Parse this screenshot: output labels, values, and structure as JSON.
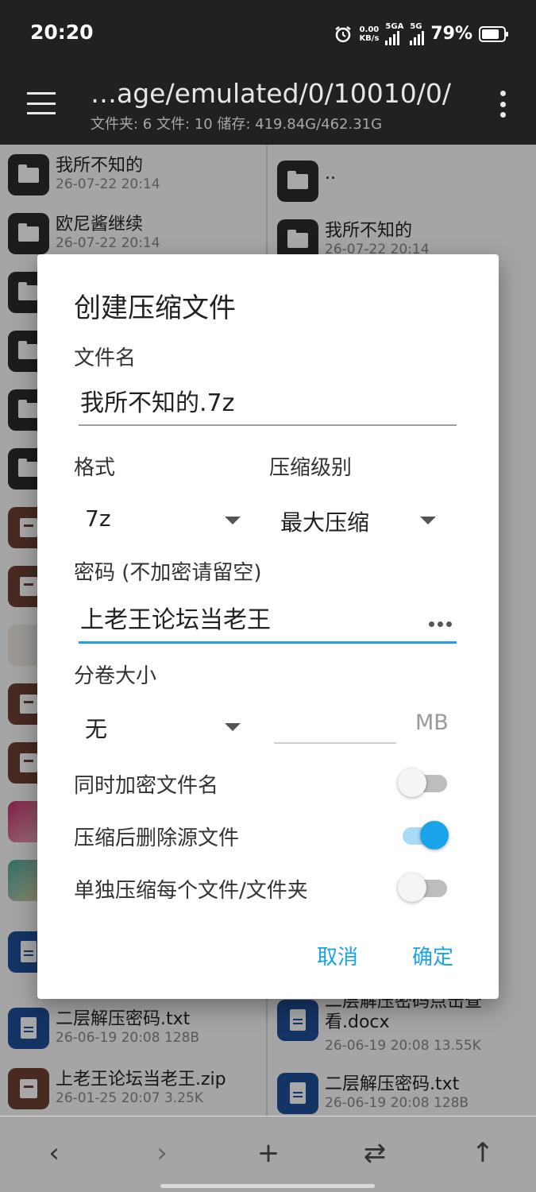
{
  "status_bar": {
    "time": "20:20",
    "net_speed_value": "0.00",
    "net_speed_unit": "KB/s",
    "signal1_label": "5GA",
    "signal2_label": "5G",
    "battery_percent": "79%",
    "battery_level": 0.79
  },
  "toolbar": {
    "path": "…age/emulated/0/10010/0/",
    "summary": "文件夹: 6  文件: 10  储存: 419.84G/462.31G"
  },
  "left_pane": {
    "items": [
      {
        "name": "我所不知的",
        "meta": "26-07-22 20:14",
        "icon": "folder-icon"
      },
      {
        "name": "欧尼酱继续",
        "meta": "26-07-22 20:14",
        "icon": "folder-icon"
      },
      {
        "name": "",
        "meta": "",
        "icon": "folder-icon"
      },
      {
        "name": "",
        "meta": "",
        "icon": "folder-icon"
      },
      {
        "name": "",
        "meta": "",
        "icon": "folder-icon"
      },
      {
        "name": "",
        "meta": "",
        "icon": "folder-icon"
      },
      {
        "name": "",
        "meta": "",
        "icon": "archive-icon"
      },
      {
        "name": "",
        "meta": "",
        "icon": "archive-icon"
      },
      {
        "name": "",
        "meta": "",
        "icon": "image-thumbnail"
      },
      {
        "name": "",
        "meta": "",
        "icon": "archive-icon"
      },
      {
        "name": "",
        "meta": "",
        "icon": "archive-icon"
      },
      {
        "name": "",
        "meta": "",
        "icon": "image-thumbnail"
      },
      {
        "name": "",
        "meta": "",
        "icon": "image-thumbnail"
      },
      {
        "name": "",
        "meta": "",
        "icon": "document-icon"
      },
      {
        "name": "二层解压密码.txt",
        "meta": "26-06-19 20:08  128B",
        "icon": "document-icon"
      },
      {
        "name": "上老王论坛当老王.zip",
        "meta": "26-01-25 20:07  3.25K",
        "icon": "archive-icon"
      }
    ]
  },
  "right_pane": {
    "items": [
      {
        "name": "..",
        "meta": "",
        "icon": "folder-icon"
      },
      {
        "name": "我所不知的",
        "meta": "26-07-22 20:14",
        "icon": "folder-icon"
      },
      {
        "name": "二层解压密码点击查看.docx",
        "meta": "26-06-19 20:08  13.55K",
        "icon": "document-icon"
      },
      {
        "name": "二层解压密码.txt",
        "meta": "26-06-19 20:08  128B",
        "icon": "document-icon"
      }
    ]
  },
  "dialog": {
    "title": "创建压缩文件",
    "filename_label": "文件名",
    "filename_value": "我所不知的.7z",
    "format_label": "格式",
    "format_value": "7z",
    "level_label": "压缩级别",
    "level_value": "最大压缩",
    "password_label": "密码 (不加密请留空)",
    "password_value": "上老王论坛当老王",
    "volume_label": "分卷大小",
    "volume_value": "无",
    "volume_unit": "MB",
    "encrypt_names_label": "同时加密文件名",
    "encrypt_names_on": false,
    "delete_source_label": "压缩后删除源文件",
    "delete_source_on": true,
    "separate_label": "单独压缩每个文件/文件夹",
    "separate_on": false,
    "cancel_label": "取消",
    "ok_label": "确定"
  },
  "bottom_bar": {
    "back_glyph": "‹",
    "forward_glyph": "›",
    "add_glyph": "+",
    "swap_glyph": "⇄",
    "up_glyph": "↑"
  },
  "colors": {
    "accent": "#1aa3e8",
    "toolbar_bg": "#212121"
  }
}
